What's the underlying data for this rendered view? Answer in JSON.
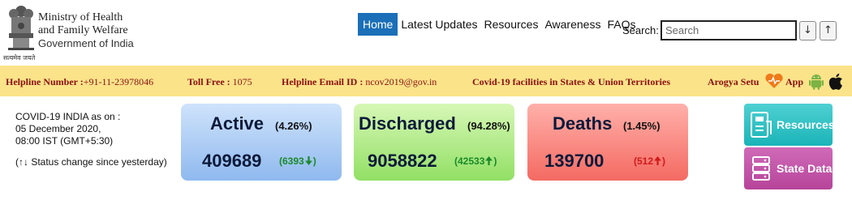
{
  "header": {
    "motto": "सत्यमेव जयते",
    "ministry_line1": "Ministry of Health",
    "ministry_line2": "and Family Welfare",
    "government": "Government of India"
  },
  "nav": {
    "items": [
      {
        "label": "Home",
        "active": true
      },
      {
        "label": "Latest Updates",
        "active": false
      },
      {
        "label": "Resources",
        "active": false
      },
      {
        "label": "Awareness",
        "active": false
      },
      {
        "label": "FAQs",
        "active": false
      }
    ]
  },
  "search": {
    "label": "Search:",
    "placeholder": "Search",
    "down_arrow": "↓",
    "up_arrow": "↑"
  },
  "helpline": {
    "number_label": "Helpline Number :",
    "number_value": "+91-11-23978046",
    "tollfree_label": "Toll Free :",
    "tollfree_value": "1075",
    "email_label": "Helpline Email ID :",
    "email_value": "ncov2019@gov.in",
    "facilities_link": "Covid-19 facilities in States & Union Territories",
    "app_label_1": "Arogya Setu",
    "app_label_2": "App"
  },
  "status": {
    "line1": "COVID-19 INDIA as on :",
    "line2": "05 December 2020,",
    "line3": "08:00 IST (GMT+5:30)",
    "note": "(↑↓ Status change since yesterday)"
  },
  "cards": {
    "active": {
      "title": "Active",
      "pct": "(4.26%)",
      "value": "409689",
      "change": "(6393",
      "direction": "down",
      "color_from": "#cfe3fb",
      "color_to": "#8fb9ef",
      "change_color": "#1a8a2a"
    },
    "discharged": {
      "title": "Discharged",
      "pct": "(94.28%)",
      "value": "9058822",
      "change": "(42533",
      "direction": "up",
      "color_from": "#d7f7b6",
      "color_to": "#92e065",
      "change_color": "#1a8a2a"
    },
    "deaths": {
      "title": "Deaths",
      "pct": "(1.45%)",
      "value": "139700",
      "change": "(512",
      "direction": "up",
      "color_from": "#ffb0aa",
      "color_to": "#f46a62",
      "change_color": "#d11a1a"
    }
  },
  "side_buttons": {
    "resources": "Resources",
    "state_data": "State Data"
  },
  "colors": {
    "nav_active": "#1a6fb8",
    "helpbar": "#fbe38a",
    "helpbar_text": "#8b1010",
    "resources_btn": "#1ab4b8",
    "state_btn": "#b6449a"
  }
}
